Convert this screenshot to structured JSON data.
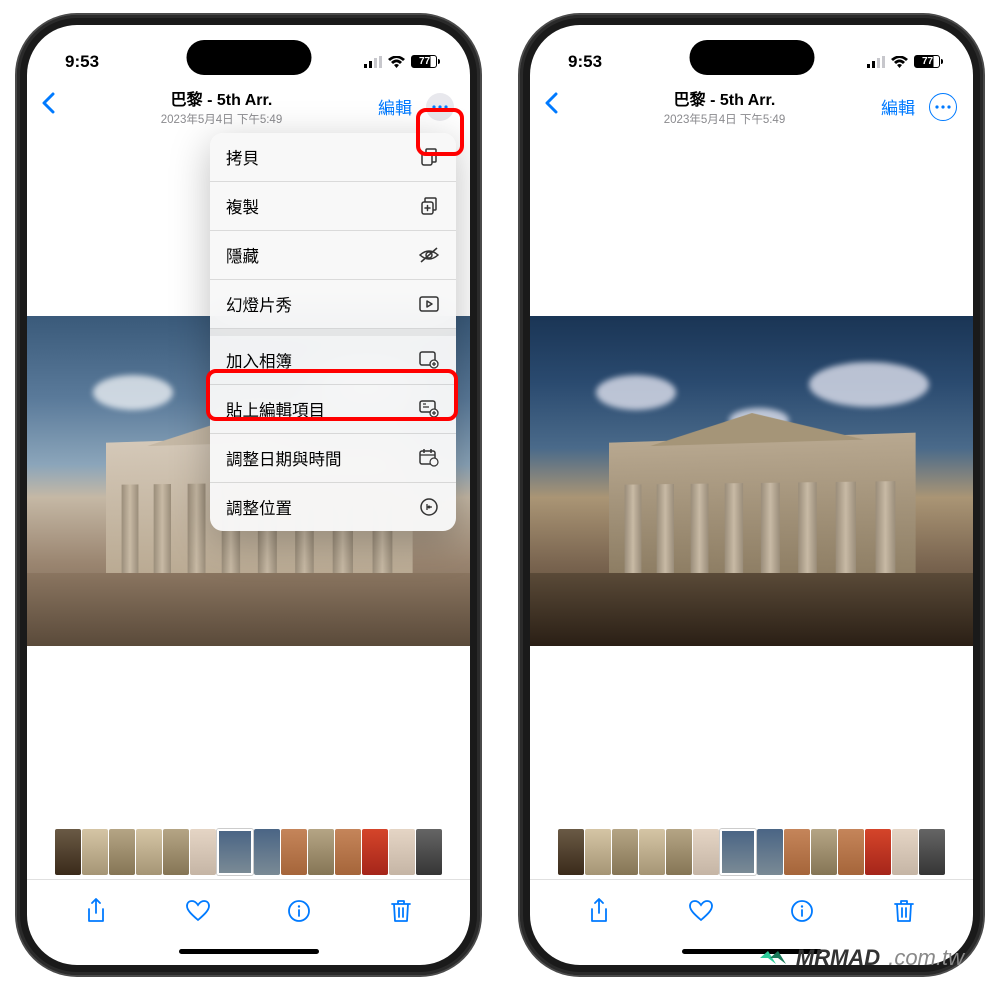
{
  "status_bar": {
    "time": "9:53",
    "battery_pct": "77"
  },
  "nav": {
    "title": "巴黎 - 5th Arr.",
    "subtitle": "2023年5月4日 下午5:49",
    "edit_label": "編輯"
  },
  "menu": {
    "items": [
      {
        "label": "拷貝",
        "icon": "copy"
      },
      {
        "label": "複製",
        "icon": "duplicate"
      },
      {
        "label": "隱藏",
        "icon": "hide"
      },
      {
        "label": "幻燈片秀",
        "icon": "slideshow"
      }
    ],
    "items2": [
      {
        "label": "加入相簿",
        "icon": "add-album"
      },
      {
        "label": "貼上編輯項目",
        "icon": "paste-edits"
      },
      {
        "label": "調整日期與時間",
        "icon": "adjust-date"
      },
      {
        "label": "調整位置",
        "icon": "adjust-location"
      }
    ]
  },
  "watermark": {
    "brand": "MRMAD",
    "domain": ".com.tw"
  }
}
